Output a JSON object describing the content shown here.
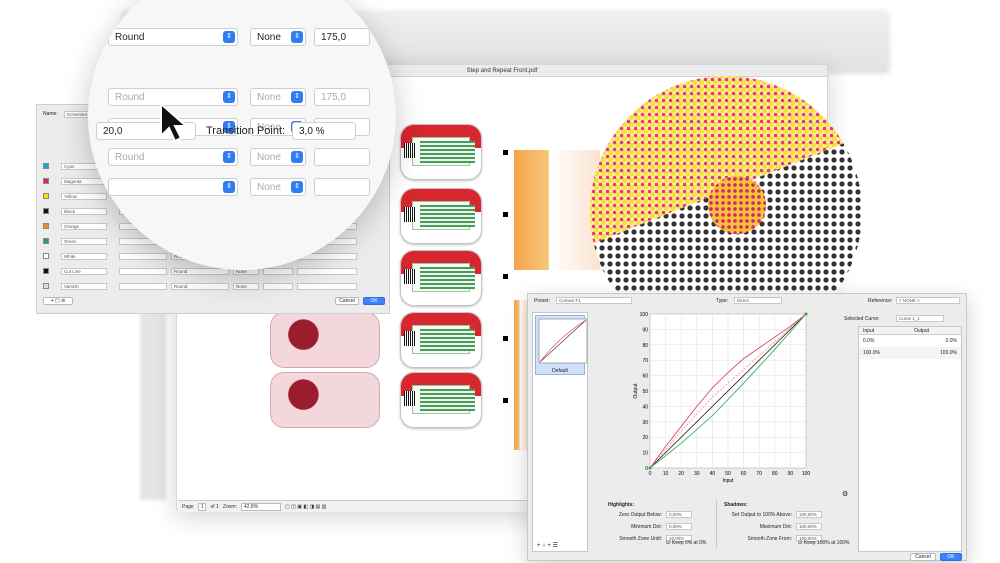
{
  "doc_window": {
    "title": "Step and Repeat Front.pdf"
  },
  "status_bar": {
    "page_label": "Page",
    "page_value": "1",
    "page_of": "of 1",
    "zoom_label": "Zoom:",
    "zoom_value": "42,8%"
  },
  "magnifier": {
    "rows": [
      {
        "style": "Round",
        "angle": "None",
        "value": "175,0",
        "dim": false
      },
      {
        "style": "Round",
        "angle": "None",
        "value": "175,0",
        "dim": true
      },
      {
        "style": "Round",
        "angle": "None",
        "value": "175",
        "dim": true
      },
      {
        "style": "Round",
        "angle": "None",
        "value": "",
        "dim": true
      },
      {
        "style": "",
        "angle": "None",
        "value": "",
        "dim": true
      }
    ],
    "min_value": "20,0",
    "transition_label": "Transition Point:",
    "transition_value": "3,0 %"
  },
  "screen_dialog": {
    "name_label": "Name:",
    "name_value": "Screenset",
    "inks": [
      {
        "name": "Cyan",
        "color": "#1aa3d8"
      },
      {
        "name": "Magenta",
        "color": "#d8237e"
      },
      {
        "name": "Yellow",
        "color": "#f2e500"
      },
      {
        "name": "Black",
        "color": "#111111"
      },
      {
        "name": "Orange",
        "color": "#f08a1c"
      },
      {
        "name": "Green",
        "color": "#1fa36a"
      },
      {
        "name": "White",
        "color": "#ffffff"
      },
      {
        "name": "Cut Line",
        "color": "#111111"
      },
      {
        "name": "Varnish",
        "color": "#e0e0e0"
      }
    ],
    "row_style": "Round",
    "row_angle": "None",
    "cancel_label": "Cancel",
    "ok_label": "OK"
  },
  "curve_dialog": {
    "preset_label": "Preset:",
    "preset_value": "Comexi F1",
    "type_label": "Type:",
    "type_value": "Direct",
    "reference_label": "Reference:",
    "reference_value": "< NONE >",
    "selected_curve_label": "Selected Curve:",
    "selected_curve_value": "Curve 1_1",
    "preset_list": [
      {
        "name": "Default"
      }
    ],
    "table_headers": [
      "Input",
      "Output"
    ],
    "table_rows": [
      [
        "0.0%",
        "0.0%"
      ],
      [
        "100.0%",
        "100.0%"
      ]
    ],
    "highlights_title": "Highlights:",
    "highlights": [
      {
        "label": "Zero Output Below:",
        "value": "0,00%"
      },
      {
        "label": "Minimum Dot:",
        "value": "0,00%"
      },
      {
        "label": "Smooth Zone Until:",
        "value": "10,00%"
      }
    ],
    "keep_highlight": "Keep 0% at 0%",
    "shadows_title": "Shadows:",
    "shadows": [
      {
        "label": "Set Output to 100% Above:",
        "value": "100,00%"
      },
      {
        "label": "Maximum Dot:",
        "value": "100,00%"
      },
      {
        "label": "Smooth Zone From:",
        "value": "100,00%"
      }
    ],
    "keep_shadow": "Keep 100% at 100%",
    "cancel_label": "Cancel",
    "ok_label": "OK"
  },
  "chart_data": {
    "type": "line",
    "xlabel": "Input",
    "ylabel": "Output",
    "xlim": [
      0,
      100
    ],
    "ylim": [
      0,
      100
    ],
    "ticks": [
      0,
      10,
      20,
      30,
      40,
      50,
      60,
      70,
      80,
      90,
      100
    ],
    "grid": true,
    "series": [
      {
        "color": "#1a1a1a",
        "x": [
          0,
          100
        ],
        "y": [
          0,
          100
        ]
      },
      {
        "color": "#e0304a",
        "x": [
          0,
          10,
          20,
          30,
          40,
          50,
          60,
          70,
          80,
          90,
          100
        ],
        "y": [
          0,
          14,
          27,
          40,
          52,
          62,
          71,
          78,
          85,
          92,
          100
        ]
      },
      {
        "color": "#2aa84a",
        "x": [
          0,
          20,
          40,
          60,
          80,
          100
        ],
        "y": [
          0,
          16,
          34,
          55,
          77,
          100
        ]
      },
      {
        "color": "#f08aa0",
        "x": [
          0,
          20,
          40,
          60,
          80,
          100
        ],
        "y": [
          0,
          24,
          46,
          64,
          82,
          100
        ]
      }
    ]
  }
}
